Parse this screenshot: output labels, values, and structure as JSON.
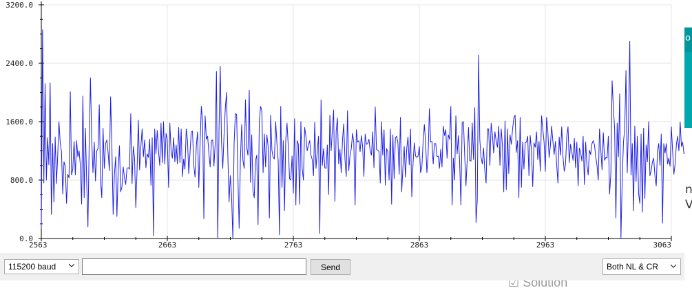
{
  "window": {
    "baud_select": "115200 baud",
    "line_ending_select": "Both NL & CR",
    "send_label": "Send",
    "input_value": "",
    "behind_text": "Solution",
    "right_edge_glyphs": [
      "o",
      "n",
      "V"
    ]
  },
  "colors": {
    "line": "#1f1fe6",
    "grid": "#e6e6e6",
    "axis": "#000000",
    "accent": "#00979c"
  },
  "chart_data": {
    "type": "line",
    "title": "",
    "xlabel": "",
    "ylabel": "",
    "xlim": [
      2563,
      3063
    ],
    "ylim": [
      0,
      3200
    ],
    "x_ticks": [
      2563,
      2663,
      2763,
      2863,
      2963,
      3063
    ],
    "x_tick_labels": [
      "2563",
      "2663",
      "2763",
      "2863",
      "2963",
      "3063"
    ],
    "y_ticks": [
      0,
      800,
      1600,
      2400,
      3200
    ],
    "y_tick_labels": [
      "0.0",
      "800.0",
      "1600.0",
      "2400.0",
      "3200.0"
    ],
    "grid": true,
    "series": [
      {
        "x_start": 2563,
        "x_step": 1,
        "values": [
          140,
          2860,
          760,
          2120,
          800,
          1380,
          1010,
          2130,
          330,
          1300,
          500,
          1390,
          750,
          1130,
          1600,
          1310,
          1190,
          610,
          1050,
          990,
          480,
          880,
          830,
          2010,
          870,
          950,
          1330,
          870,
          1340,
          1120,
          1200,
          1000,
          470,
          1950,
          560,
          1510,
          780,
          160,
          1310,
          2200,
          1350,
          900,
          1320,
          790,
          1200,
          1230,
          1830,
          790,
          560,
          1510,
          960,
          1300,
          1350,
          1180,
          930,
          1940,
          1260,
          330,
          870,
          1120,
          300,
          940,
          1270,
          640,
          710,
          980,
          830,
          740,
          960,
          970,
          950,
          1710,
          750,
          1260,
          1100,
          420,
          940,
          1620,
          940,
          1260,
          1500,
          1120,
          1350,
          970,
          1160,
          1110,
          1360,
          730,
          1380,
          40,
          1500,
          1160,
          1480,
          1200,
          1000,
          1580,
          1040,
          1600,
          1020,
          1440,
          1350,
          700,
          1580,
          1200,
          1100,
          1380,
          1050,
          1280,
          1020,
          1520,
          1040,
          1500,
          850,
          1090,
          950,
          1500,
          1350,
          890,
          1170,
          1460,
          1470,
          1000,
          840,
          1270,
          1460,
          700,
          1310,
          1810,
          1600,
          270,
          1680,
          1360,
          1400,
          1160,
          980,
          1340,
          1350,
          990,
          1300,
          2290,
          0,
          1460,
          2360,
          1320,
          960,
          1410,
          1780,
          2000,
          1160,
          500,
          860,
          580,
          0,
          1300,
          1710,
          1700,
          860,
          140,
          1080,
          1560,
          1070,
          960,
          1900,
          1250,
          1140,
          2030,
          770,
          1420,
          650,
          560,
          1070,
          1140,
          190,
          1600,
          1810,
          1750,
          900,
          1430,
          980,
          1420,
          1260,
          280,
          1690,
          1210,
          1110,
          1090,
          1600,
          1300,
          1060,
          50,
          1810,
          700,
          1340,
          380,
          1360,
          1580,
          1260,
          820,
          800,
          1130,
          620,
          1640,
          460,
          1340,
          1290,
          470,
          1600,
          960,
          800,
          1520,
          1400,
          1200,
          1280,
          1340,
          1140,
          1080,
          860,
          1590,
          960,
          1200,
          1400,
          70,
          1900,
          1000,
          1230,
          970,
          960,
          1280,
          600,
          1690,
          1200,
          1490,
          1760,
          510,
          1470,
          1650,
          1020,
          1220,
          900,
          1340,
          1570,
          1080,
          850,
          1750,
          930,
          1140,
          1230,
          1440,
          1310,
          460,
          1490,
          1320,
          1340,
          1190,
          1410,
          1260,
          850,
          1430,
          1290,
          1300,
          1360,
          1200,
          1140,
          1460,
          970,
          1800,
          1220,
          1210,
          1190,
          760,
          1600,
          1140,
          1490,
          730,
          1230,
          1190,
          800,
          1500,
          470,
          1420,
          820,
          1380,
          1400,
          1310,
          880,
          1660,
          640,
          980,
          1260,
          840,
          1230,
          1390,
          1010,
          1500,
          570,
          1030,
          1310,
          1130,
          1110,
          1130,
          1260,
          900,
          980,
          1320,
          1560,
          1300,
          900,
          1160,
          1780,
          1320,
          1330,
          1020,
          1300,
          1300,
          1120,
          1130,
          960,
          1220,
          980,
          1540,
          1410,
          1490,
          1100,
          1420,
          1360,
          1810,
          460,
          1100,
          800,
          1680,
          1160,
          1410,
          1040,
          460,
          1590,
          1600,
          1140,
          720,
          1080,
          1520,
          1070,
          1060,
          1580,
          1080,
          1790,
          220,
          530,
          2510,
          1350,
          1110,
          1020,
          1240,
          920,
          760,
          1500,
          1500,
          1000,
          1580,
          1420,
          1170,
          1460,
          1330,
          1250,
          1540,
          1000,
          1500,
          1260,
          640,
          1610,
          670,
          1500,
          890,
          1420,
          1290,
          1500,
          1650,
          1690,
          1180,
          1340,
          560,
          1660,
          700,
          1320,
          950,
          1310,
          1320,
          1400,
          860,
          1410,
          1200,
          710,
          1310,
          1250,
          1460,
          1080,
          1330,
          920,
          1680,
          1500,
          1320,
          920,
          1660,
          1460,
          1110,
          1270,
          1540,
          1330,
          1150,
          1330,
          1010,
          760,
          1390,
          1140,
          1530,
          1120,
          920,
          1010,
          1400,
          1530,
          1040,
          1290,
          1190,
          1070,
          1370,
          970,
          1320,
          720,
          1240,
          1180,
          1060,
          1400,
          740,
          1320,
          1010,
          870,
          1210,
          1150,
          1300,
          1340,
          1280,
          1120,
          1000,
          800,
          1500,
          1220,
          940,
          1450,
          1070,
          1110,
          1100,
          1400,
          610,
          880,
          2160,
          1790,
          1500,
          280,
          1580,
          1120,
          1980,
          0,
          800,
          1320,
          1500,
          2300,
          900,
          1560,
          2700,
          870,
          1300,
          380,
          1540,
          780,
          1400,
          620,
          480,
          1430,
          360,
          1510,
          550,
          1280,
          1050,
          1600,
          860,
          930,
          1050,
          1100,
          850,
          720,
          1200,
          1300,
          1000,
          1430,
          210,
          1300,
          1170,
          1300,
          1020,
          1100,
          990,
          1530,
          1200,
          880,
          1020,
          1290,
          1400,
          1200,
          1600,
          1260,
          1320,
          1160,
          1180,
          1400,
          1000,
          1560,
          1220,
          1050,
          280,
          960,
          1600,
          660
        ]
      }
    ]
  }
}
